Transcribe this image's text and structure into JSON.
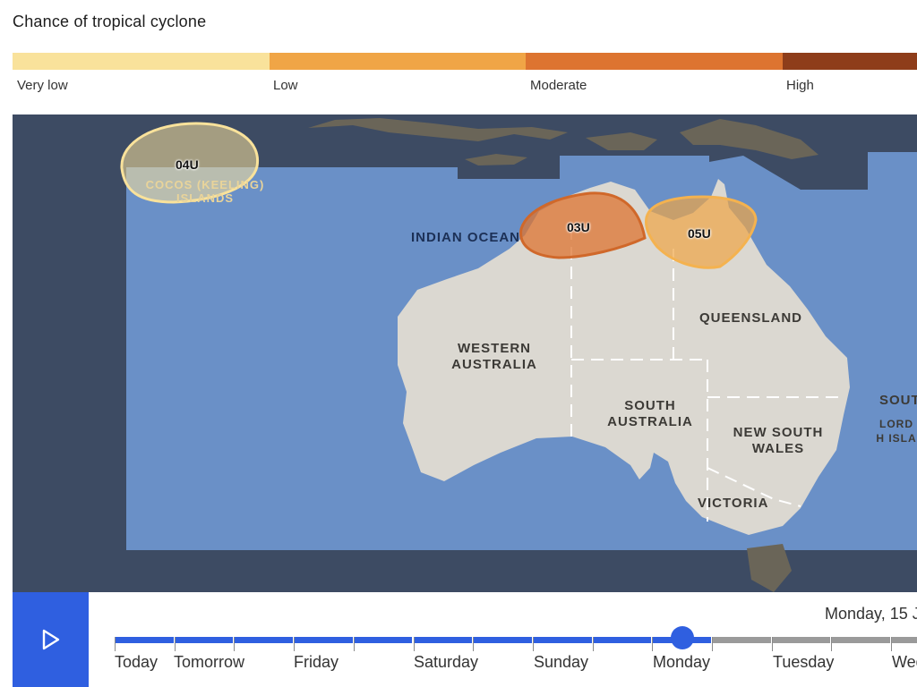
{
  "title": "Chance of tropical cyclone",
  "legend": [
    {
      "label": "Very low",
      "color": "#f9e29b"
    },
    {
      "label": "Low",
      "color": "#f0a546"
    },
    {
      "label": "Moderate",
      "color": "#dd7430"
    },
    {
      "label": "High",
      "color": "#8e3d1a"
    }
  ],
  "map": {
    "ocean_label": "INDIAN OCEAN",
    "regions": {
      "wa": "WESTERN AUSTRALIA",
      "sa": "SOUTH AUSTRALIA",
      "qld": "QUEENSLAND",
      "nsw": "NEW SOUTH WALES",
      "vic": "VICTORIA",
      "cocos": "COCOS (KEELING) ISLANDS",
      "south_cut": "SOUT",
      "lord_howe": "LORD H ISLA"
    },
    "zones": [
      {
        "id": "04U",
        "chance": "Very low"
      },
      {
        "id": "03U",
        "chance": "Moderate"
      },
      {
        "id": "05U",
        "chance": "Low"
      }
    ]
  },
  "timeline": {
    "play_icon": "play-icon",
    "current_date": "Monday, 15 J",
    "days": [
      "Today",
      "Tomorrow",
      "Friday",
      "Saturday",
      "Sunday",
      "Monday",
      "Tuesday",
      "Wed"
    ],
    "selected_day": "Monday",
    "active_color": "#2f5fe0",
    "inactive_color": "#9a9a9a"
  }
}
